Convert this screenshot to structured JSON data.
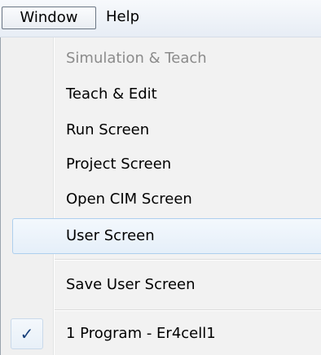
{
  "menubar": {
    "items": [
      {
        "label": "Window"
      },
      {
        "label": "Help"
      }
    ]
  },
  "window_menu": {
    "items": [
      {
        "label": "Simulation & Teach",
        "enabled": false
      },
      {
        "label": "Teach & Edit",
        "enabled": true
      },
      {
        "label": "Run Screen",
        "enabled": true
      },
      {
        "label": "Project Screen",
        "enabled": true
      },
      {
        "label": "Open CIM Screen",
        "enabled": true
      },
      {
        "label": "User Screen",
        "enabled": true,
        "highlighted": true
      },
      {
        "label": "Save User Screen",
        "enabled": true
      },
      {
        "label": "1 Program -  Er4cell1",
        "enabled": true,
        "checked": true
      }
    ],
    "check_icon": "checkmark-icon",
    "check_glyph": "✓",
    "colors": {
      "highlight_border": "#aecfee",
      "disabled_text": "#8b8b8b",
      "check_color": "#173f7a"
    }
  }
}
